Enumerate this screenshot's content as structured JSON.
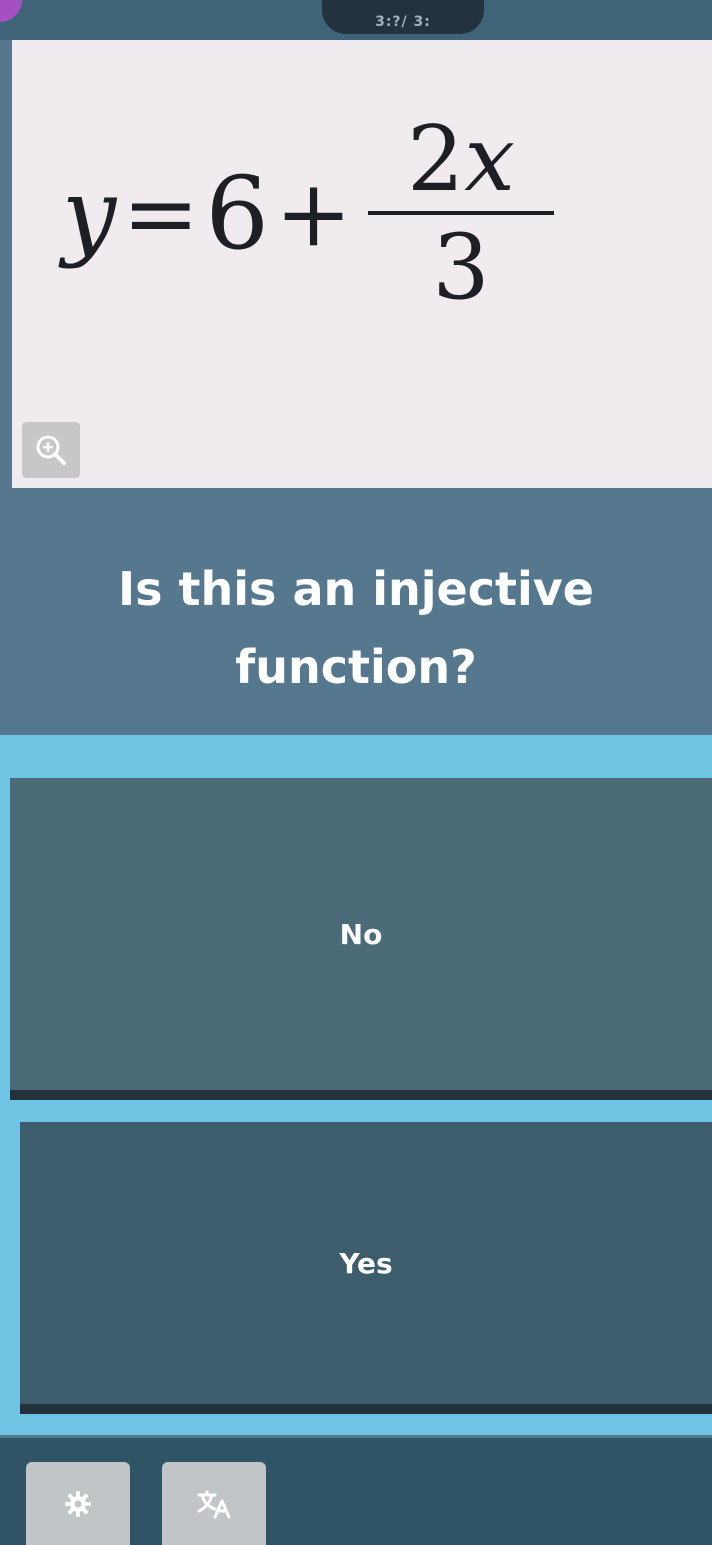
{
  "status": {
    "text": "3:?/ 3:"
  },
  "equation": {
    "lhs": "y",
    "equals": "=",
    "constant": "6",
    "plus": "+",
    "numerator_coef": "2",
    "numerator_var": "x",
    "denominator": "3"
  },
  "question": {
    "line1": "Is this an injective",
    "line2": "function?"
  },
  "answers": [
    {
      "label": "No"
    },
    {
      "label": "Yes"
    }
  ],
  "toolbar": {
    "icons": [
      "settings-icon",
      "translate-icon",
      "zoom-in-icon"
    ]
  },
  "colors": {
    "card": "#f0ebee",
    "background": "#55788f",
    "answer_area": "#6fc3e3",
    "option_no": "#4c6b79",
    "option_yes": "#3d5d6c"
  }
}
